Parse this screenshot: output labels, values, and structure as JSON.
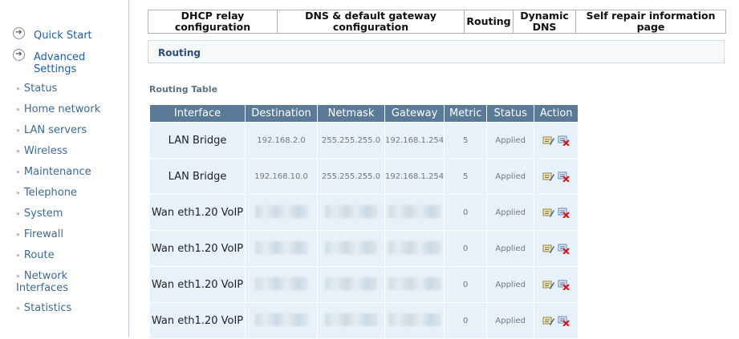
{
  "sidebar": {
    "quick_start": "Quick Start",
    "advanced_settings": "Advanced Settings",
    "items": [
      {
        "label": "Status"
      },
      {
        "label": "Home network"
      },
      {
        "label": "LAN servers"
      },
      {
        "label": "Wireless"
      },
      {
        "label": "Maintenance"
      },
      {
        "label": "Telephone"
      },
      {
        "label": "System"
      },
      {
        "label": "Firewall"
      },
      {
        "label": "Route"
      },
      {
        "label": "Network Interfaces"
      },
      {
        "label": "Statistics"
      }
    ]
  },
  "tabs": [
    {
      "label": "DHCP relay configuration"
    },
    {
      "label": "DNS & default gateway configuration"
    },
    {
      "label": "Routing"
    },
    {
      "label": "Dynamic DNS"
    },
    {
      "label": "Self repair information page"
    }
  ],
  "section": {
    "title": "Routing"
  },
  "table": {
    "title": "Routing Table",
    "headers": [
      "Interface",
      "Destination",
      "Netmask",
      "Gateway",
      "Metric",
      "Status",
      "Action"
    ],
    "rows": [
      {
        "interface": "LAN Bridge",
        "destination": "192.168.2.0",
        "netmask": "255.255.255.0",
        "gateway": "192.168.1.254",
        "metric": "5",
        "status": "Applied"
      },
      {
        "interface": "LAN Bridge",
        "destination": "192.168.10.0",
        "netmask": "255.255.255.0",
        "gateway": "192.168.1.254",
        "metric": "5",
        "status": "Applied"
      },
      {
        "interface": "Wan eth1.20 VoIP",
        "destination": "",
        "netmask": "",
        "gateway": "",
        "metric": "0",
        "status": "Applied"
      },
      {
        "interface": "Wan eth1.20 VoIP",
        "destination": "",
        "netmask": "",
        "gateway": "",
        "metric": "0",
        "status": "Applied"
      },
      {
        "interface": "Wan eth1.20 VoIP",
        "destination": "",
        "netmask": "",
        "gateway": "",
        "metric": "0",
        "status": "Applied"
      },
      {
        "interface": "Wan eth1.20 VoIP",
        "destination": "",
        "netmask": "",
        "gateway": "",
        "metric": "0",
        "status": "Applied"
      }
    ]
  },
  "icons": {
    "edit": "edit-icon",
    "delete": "delete-icon"
  },
  "colors": {
    "header_bg": "#5a7a97",
    "cell_bg": "#e7f1f9",
    "link": "#3d6a96"
  }
}
